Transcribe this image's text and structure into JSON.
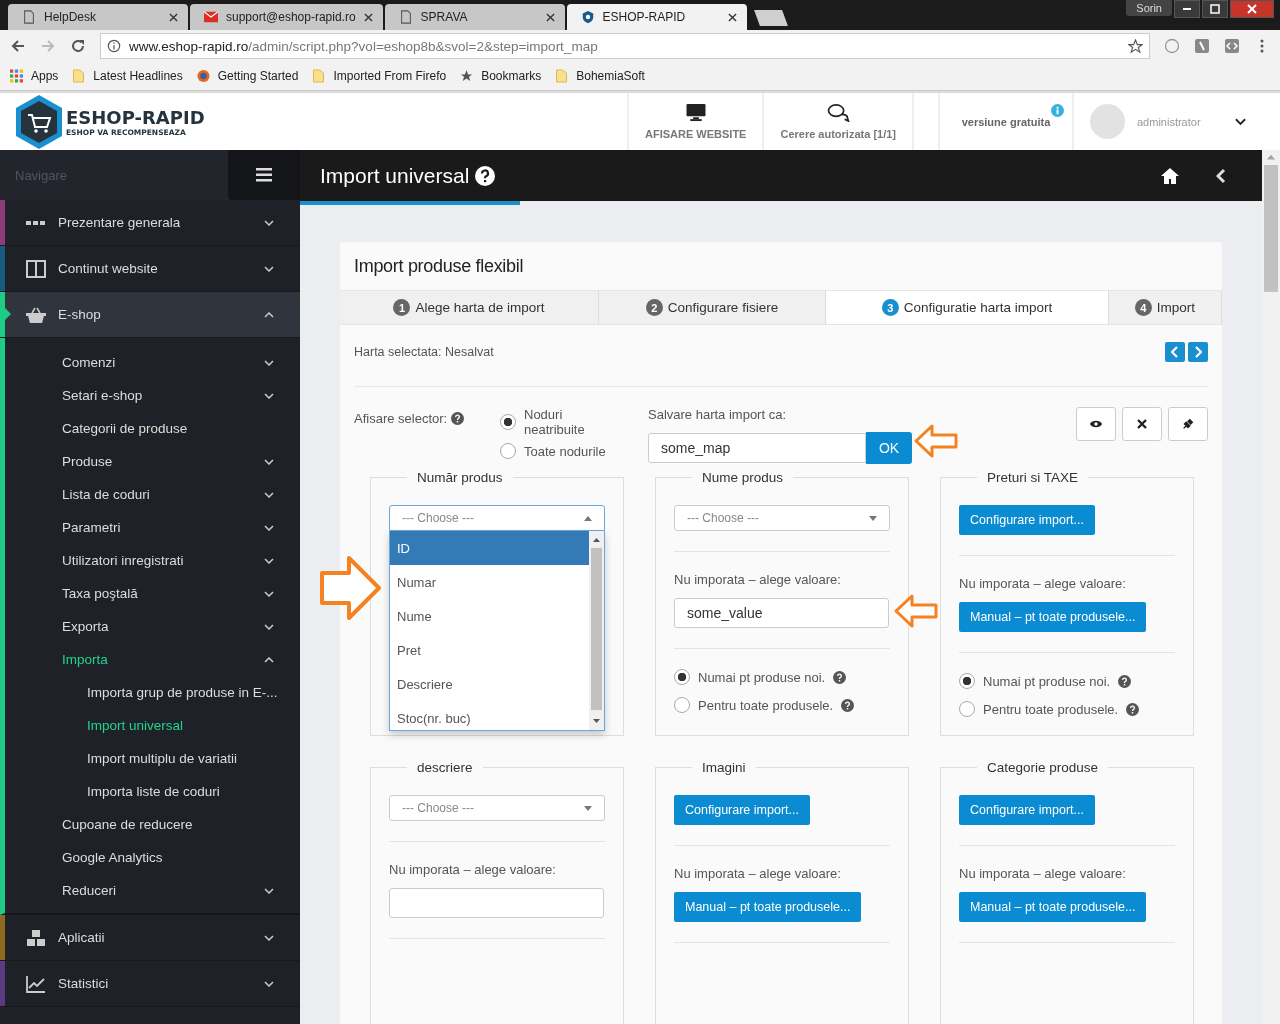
{
  "browser": {
    "tabs": [
      {
        "title": "HelpDesk",
        "selected": false
      },
      {
        "title": "support@eshop-rapid.ro",
        "selected": false
      },
      {
        "title": "SPRAVA",
        "selected": false
      },
      {
        "title": "ESHOP-RAPID",
        "selected": true
      }
    ],
    "profile": "Sorin",
    "url": {
      "host": "www.eshop-rapid.ro",
      "path": "/admin/script.php?vol=eshop8b&svol=2&step=import_map"
    },
    "bookmarks": [
      "Apps",
      "Latest Headlines",
      "Getting Started",
      "Imported From Firefo",
      "Bookmarks",
      "BohemiaSoft"
    ]
  },
  "header": {
    "logo": {
      "name": "ESHOP-RAPID",
      "tagline": "ESHOP VA RECOMPENSEAZA"
    },
    "nav": [
      "AFISARE WEBSITE",
      "Cerere autorizata [1/1]"
    ],
    "version": "versiune gratuita",
    "user": "administrator"
  },
  "sidebar": {
    "title": "Navigare",
    "items": [
      {
        "label": "Prezentare generala",
        "color": "#8e3b78",
        "selected": false,
        "expandable": true,
        "expanded": false
      },
      {
        "label": "Continut website",
        "color": "#175b80",
        "selected": false,
        "expandable": true,
        "expanded": false
      },
      {
        "label": "E-shop",
        "color": "#1ecc88",
        "selected": true,
        "expandable": true,
        "expanded": true,
        "children": [
          {
            "label": "Comenzi",
            "selected": false,
            "expandable": true,
            "expanded": false
          },
          {
            "label": "Setari e-shop",
            "selected": false,
            "expandable": true,
            "expanded": false
          },
          {
            "label": "Categorii de produse",
            "selected": false,
            "expandable": false
          },
          {
            "label": "Produse",
            "selected": false,
            "expandable": true,
            "expanded": false
          },
          {
            "label": "Lista de coduri",
            "selected": false,
            "expandable": true,
            "expanded": false
          },
          {
            "label": "Parametri",
            "selected": false,
            "expandable": true,
            "expanded": false
          },
          {
            "label": "Utilizatori inregistrati",
            "selected": false,
            "expandable": true,
            "expanded": false
          },
          {
            "label": "Taxa poştală",
            "selected": false,
            "expandable": true,
            "expanded": false
          },
          {
            "label": "Exporta",
            "selected": false,
            "expandable": true,
            "expanded": false
          },
          {
            "label": "Importa",
            "selected": true,
            "expandable": true,
            "expanded": true,
            "children": [
              {
                "label": "Importa grup de produse in E-...",
                "selected": false
              },
              {
                "label": "Import universal",
                "selected": true
              },
              {
                "label": "Import multiplu de variatii",
                "selected": false
              },
              {
                "label": "Importa liste de coduri",
                "selected": false
              }
            ]
          },
          {
            "label": "Cupoane de reducere",
            "selected": false,
            "expandable": false
          },
          {
            "label": "Google Analytics",
            "selected": false,
            "expandable": false
          },
          {
            "label": "Reduceri",
            "selected": false,
            "expandable": true,
            "expanded": false
          }
        ]
      },
      {
        "label": "Aplicatii",
        "color": "#8c6a20",
        "selected": false,
        "expandable": true,
        "expanded": false
      },
      {
        "label": "Statistici",
        "color": "#5c3a82",
        "selected": false,
        "expandable": true,
        "expanded": false
      }
    ]
  },
  "page": {
    "title": "Import universal"
  },
  "card": {
    "title": "Import produse flexibil",
    "steps": [
      {
        "number": "1",
        "label": "Alege harta de import",
        "selected": false
      },
      {
        "number": "2",
        "label": "Configurare fisiere",
        "selected": false
      },
      {
        "number": "3",
        "label": "Configuratie harta import",
        "selected": true
      },
      {
        "number": "4",
        "label": "Import",
        "selected": false
      }
    ],
    "selected_map": "Harta selectata: Nesalvat",
    "selector": {
      "label": "Afisare selector:",
      "options": [
        {
          "label": "Noduri neatribuite",
          "selected": true
        },
        {
          "label": "Toate nodurile",
          "selected": false
        }
      ]
    },
    "save": {
      "label": "Salvare harta import ca:",
      "value": "some_map",
      "button": "OK"
    },
    "groups": [
      {
        "legend": "Număr produs",
        "source": {
          "kind": "select",
          "placeholder": "--- Choose ---",
          "expanded": true,
          "options": [
            {
              "label": "ID",
              "selected": true
            },
            {
              "label": "Numar",
              "selected": false
            },
            {
              "label": "Nume",
              "selected": false
            },
            {
              "label": "Pret",
              "selected": false
            },
            {
              "label": "Descriere",
              "selected": false
            },
            {
              "label": "Stoc(nr. buc)",
              "selected": false
            }
          ]
        }
      },
      {
        "legend": "Nume produs",
        "source": {
          "kind": "select",
          "placeholder": "--- Choose ---",
          "expanded": false
        },
        "manual": {
          "label": "Nu imporata – alege valoare:",
          "kind": "input",
          "value": "some_value"
        },
        "scope": [
          {
            "label": "Numai pt produse noi.",
            "selected": true
          },
          {
            "label": "Pentru toate produsele.",
            "selected": false
          }
        ]
      },
      {
        "legend": "Preturi si TAXE",
        "source": {
          "kind": "button",
          "text": "Configurare import..."
        },
        "manual": {
          "label": "Nu imporata – alege valoare:",
          "kind": "button",
          "text": "Manual – pt toate produsele..."
        },
        "scope": [
          {
            "label": "Numai pt produse noi.",
            "selected": true
          },
          {
            "label": "Pentru toate produsele.",
            "selected": false
          }
        ]
      },
      {
        "legend": "descriere",
        "source": {
          "kind": "select",
          "placeholder": "--- Choose ---",
          "expanded": false
        },
        "manual": {
          "label": "Nu imporata – alege valoare:",
          "kind": "input"
        }
      },
      {
        "legend": "Imagini",
        "source": {
          "kind": "button",
          "text": "Configurare import..."
        },
        "manual": {
          "label": "Nu imporata – alege valoare:",
          "kind": "button",
          "text": "Manual – pt toate produsele..."
        }
      },
      {
        "legend": "Categorie produse",
        "source": {
          "kind": "button",
          "text": "Configurare import..."
        },
        "manual": {
          "label": "Nu imporata – alege valoare:",
          "kind": "button",
          "text": "Manual – pt toate produsele..."
        }
      }
    ]
  }
}
